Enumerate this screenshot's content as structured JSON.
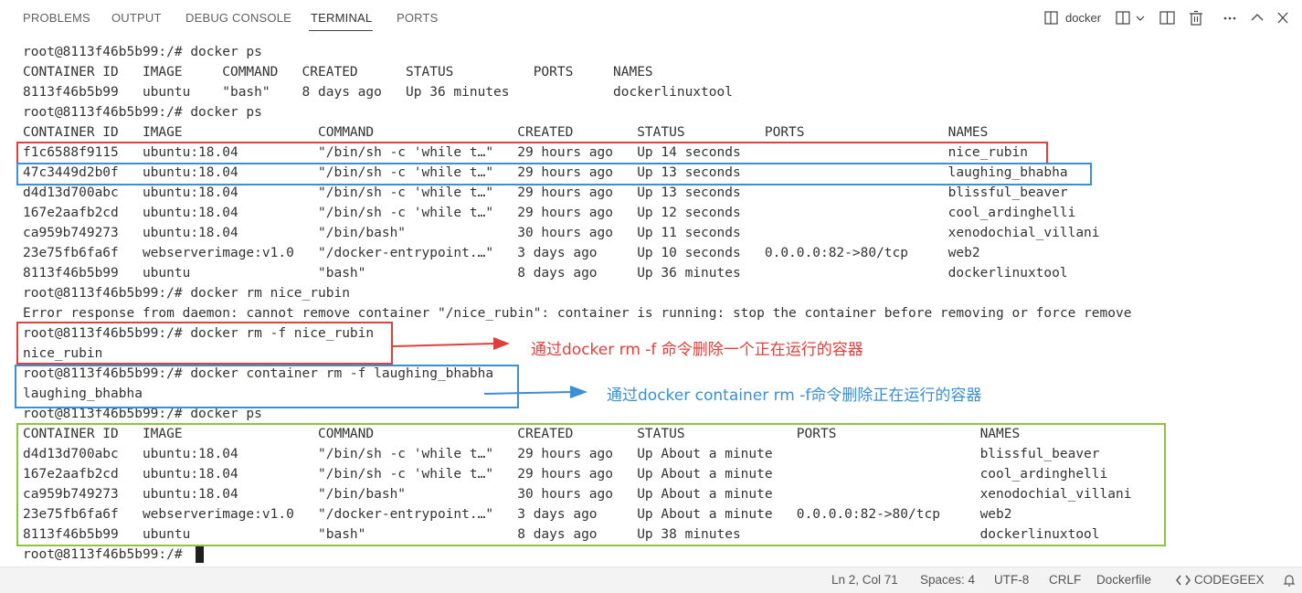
{
  "tabs": {
    "problems": "PROBLEMS",
    "output": "OUTPUT",
    "debug": "DEBUG CONSOLE",
    "terminal": "TERMINAL",
    "ports": "PORTS"
  },
  "toolbar": {
    "terminal_name": "docker"
  },
  "terminal": {
    "lines": [
      "root@8113f46b5b99:/# docker ps",
      "CONTAINER ID   IMAGE     COMMAND   CREATED      STATUS          PORTS     NAMES",
      "8113f46b5b99   ubuntu    \"bash\"    8 days ago   Up 36 minutes             dockerlinuxtool",
      "root@8113f46b5b99:/# docker ps",
      "CONTAINER ID   IMAGE                 COMMAND                  CREATED        STATUS          PORTS                  NAMES",
      "f1c6588f9115   ubuntu:18.04          \"/bin/sh -c 'while t…\"   29 hours ago   Up 14 seconds                          nice_rubin",
      "47c3449d2b0f   ubuntu:18.04          \"/bin/sh -c 'while t…\"   29 hours ago   Up 13 seconds                          laughing_bhabha",
      "d4d13d700abc   ubuntu:18.04          \"/bin/sh -c 'while t…\"   29 hours ago   Up 13 seconds                          blissful_beaver",
      "167e2aafb2cd   ubuntu:18.04          \"/bin/sh -c 'while t…\"   29 hours ago   Up 12 seconds                          cool_ardinghelli",
      "ca959b749273   ubuntu:18.04          \"/bin/bash\"              30 hours ago   Up 11 seconds                          xenodochial_villani",
      "23e75fb6fa6f   webserverimage:v1.0   \"/docker-entrypoint.…\"   3 days ago     Up 10 seconds   0.0.0.0:82->80/tcp     web2",
      "8113f46b5b99   ubuntu                \"bash\"                   8 days ago     Up 36 minutes                          dockerlinuxtool",
      "root@8113f46b5b99:/# docker rm nice_rubin",
      "Error response from daemon: cannot remove container \"/nice_rubin\": container is running: stop the container before removing or force remove",
      "root@8113f46b5b99:/# docker rm -f nice_rubin",
      "nice_rubin",
      "root@8113f46b5b99:/# docker container rm -f laughing_bhabha",
      "laughing_bhabha",
      "root@8113f46b5b99:/# docker ps",
      "CONTAINER ID   IMAGE                 COMMAND                  CREATED        STATUS              PORTS                  NAMES",
      "d4d13d700abc   ubuntu:18.04          \"/bin/sh -c 'while t…\"   29 hours ago   Up About a minute                          blissful_beaver",
      "167e2aafb2cd   ubuntu:18.04          \"/bin/sh -c 'while t…\"   29 hours ago   Up About a minute                          cool_ardinghelli",
      "ca959b749273   ubuntu:18.04          \"/bin/bash\"              30 hours ago   Up About a minute                          xenodochial_villani",
      "23e75fb6fa6f   webserverimage:v1.0   \"/docker-entrypoint.…\"   3 days ago     Up About a minute   0.0.0.0:82->80/tcp     web2",
      "8113f46b5b99   ubuntu                \"bash\"                   8 days ago     Up 38 minutes                              dockerlinuxtool",
      "root@8113f46b5b99:/# "
    ]
  },
  "annotations": {
    "red_text": "通过docker rm -f 命令删除一个正在运行的容器",
    "blue_text": "通过docker container rm -f命令删除正在运行的容器"
  },
  "colors": {
    "red": "#e0403c",
    "blue": "#3a8fd6",
    "green": "#8cc63e"
  },
  "statusbar": {
    "position": "Ln 2, Col 71",
    "spaces": "Spaces: 4",
    "encoding": "UTF-8",
    "eol": "CRLF",
    "language": "Dockerfile",
    "extension": "CODEGEEX"
  }
}
